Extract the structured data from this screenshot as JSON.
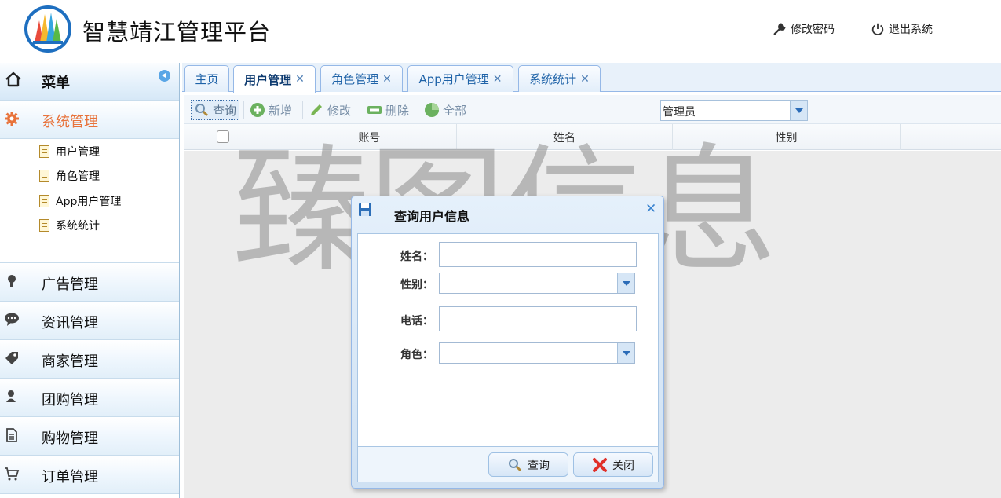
{
  "header": {
    "title": "智慧靖江管理平台",
    "change_password": "修改密码",
    "logout": "退出系统"
  },
  "sidebar": {
    "menu_title": "菜单",
    "groups": [
      {
        "label": "系统管理",
        "icon": "gear-icon",
        "active": true
      },
      {
        "label": "广告管理",
        "icon": "lightbulb-icon"
      },
      {
        "label": "资讯管理",
        "icon": "chat-bubble-icon"
      },
      {
        "label": "商家管理",
        "icon": "tag-icon"
      },
      {
        "label": "团购管理",
        "icon": "group-icon"
      },
      {
        "label": "购物管理",
        "icon": "document-icon"
      },
      {
        "label": "订单管理",
        "icon": "cart-icon"
      }
    ],
    "sub_items": [
      "用户管理",
      "角色管理",
      "App用户管理",
      "系统统计"
    ]
  },
  "tabs": [
    {
      "label": "主页",
      "closable": false
    },
    {
      "label": "用户管理",
      "closable": true,
      "selected": true
    },
    {
      "label": "角色管理",
      "closable": true
    },
    {
      "label": "App用户管理",
      "closable": true
    },
    {
      "label": "系统统计",
      "closable": true
    }
  ],
  "toolbar": {
    "query": "查询",
    "add": "新增",
    "edit": "修改",
    "delete": "删除",
    "all": "全部",
    "role_select_value": "管理员"
  },
  "grid": {
    "columns": [
      "账号",
      "姓名",
      "性别"
    ]
  },
  "watermark": "臻图信息",
  "dialog": {
    "title": "查询用户信息",
    "fields": {
      "name_label": "姓名：",
      "name_value": "",
      "gender_label": "性别：",
      "gender_value": "",
      "phone_label": "电话：",
      "phone_value": "",
      "role_label": "角色：",
      "role_value": ""
    },
    "query_button": "查询",
    "close_button": "关闭"
  },
  "colors": {
    "accent": "#1f63a8",
    "active_menu": "#e8723a",
    "panel_border": "#95b8e7"
  }
}
